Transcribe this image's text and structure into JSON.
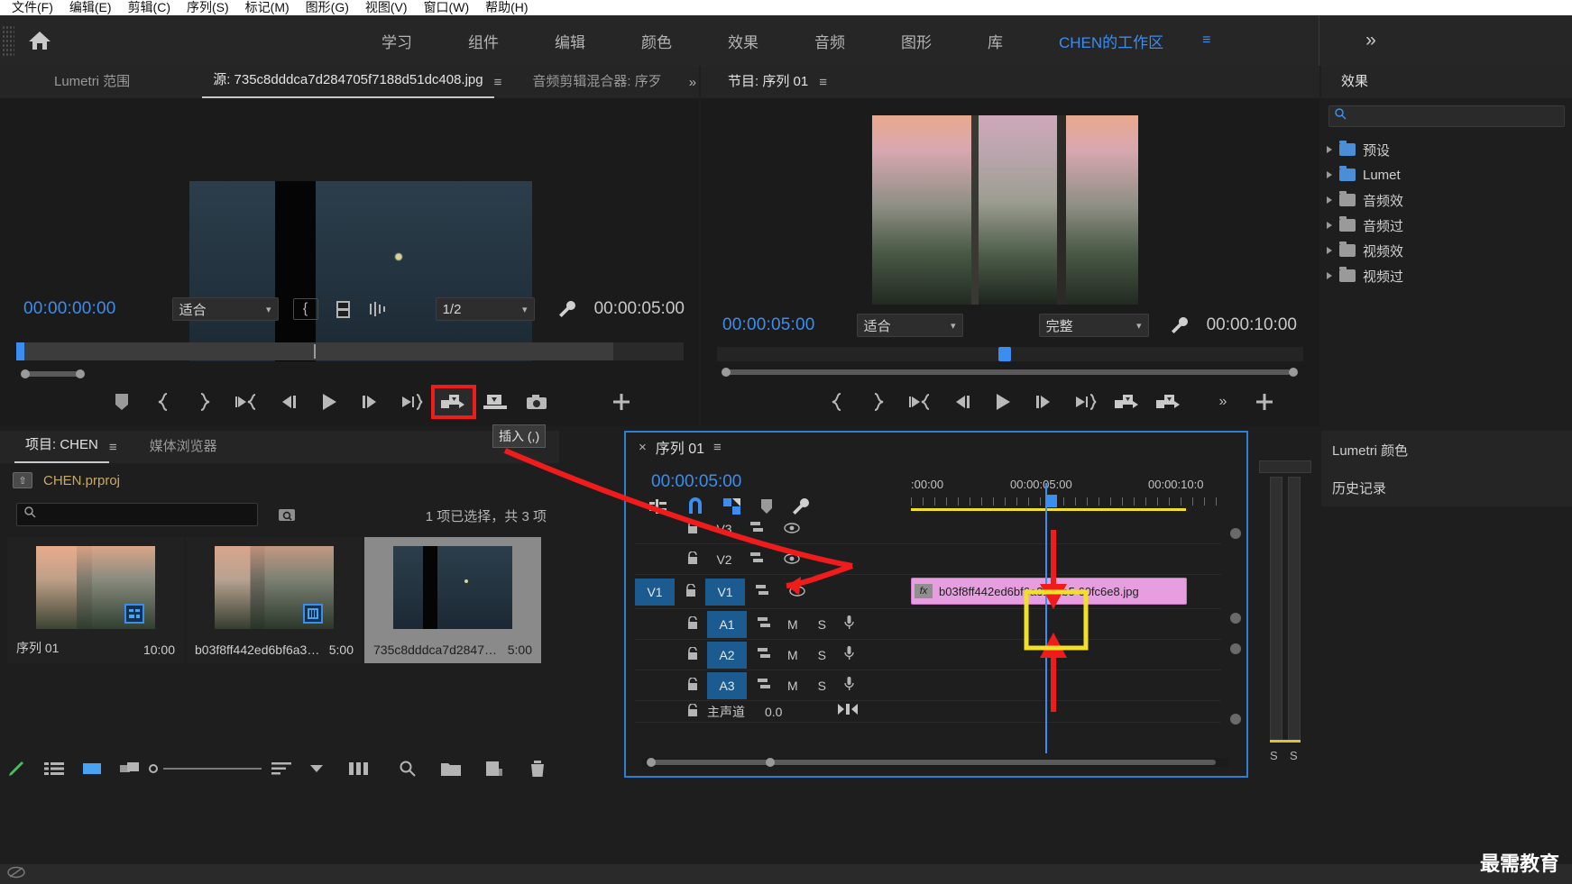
{
  "menubar": {
    "items": [
      "文件(F)",
      "编辑(E)",
      "剪辑(C)",
      "序列(S)",
      "标记(M)",
      "图形(G)",
      "视图(V)",
      "窗口(W)",
      "帮助(H)"
    ]
  },
  "workspace": {
    "home_icon": "home-icon",
    "tabs": [
      "学习",
      "组件",
      "编辑",
      "颜色",
      "效果",
      "音频",
      "图形",
      "库"
    ],
    "active_workspace": "CHEN的工作区",
    "menu_icon": "hamburger-icon",
    "more_icon": "double-chevron-right-icon",
    "accent": "#3b8ef0"
  },
  "source_panel": {
    "tabs": [
      {
        "label": "Lumetri 范围",
        "active": false
      },
      {
        "label": "源: 735c8dddca7d284705f7188d51dc408.jpg",
        "active": true
      },
      {
        "label": "音频剪辑混合器: 序歹",
        "active": false
      }
    ],
    "hamburger": "≡",
    "overflow": "»",
    "current_time": "00:00:00:00",
    "fit_value": "适合",
    "resolution_value": "1/2",
    "duration": "00:00:05:00",
    "wrench_icon": "wrench-icon",
    "marker_in_icon": "mark-in-icon",
    "export_frame_icon": "export-frame-icon",
    "settings_icon": "settings-icon"
  },
  "source_transport": {
    "buttons": [
      {
        "name": "add-marker-button",
        "glyph": "marker"
      },
      {
        "name": "mark-in-button",
        "glyph": "{"
      },
      {
        "name": "mark-out-button",
        "glyph": "}"
      },
      {
        "name": "go-to-in-button",
        "glyph": "goin"
      },
      {
        "name": "step-back-button",
        "glyph": "stepback"
      },
      {
        "name": "play-button",
        "glyph": "play"
      },
      {
        "name": "step-forward-button",
        "glyph": "stepfwd"
      },
      {
        "name": "go-to-out-button",
        "glyph": "goout"
      },
      {
        "name": "insert-button",
        "glyph": "insert",
        "highlighted": true
      },
      {
        "name": "overwrite-button",
        "glyph": "overwrite"
      },
      {
        "name": "export-frame-button",
        "glyph": "camera"
      },
      {
        "name": "button-editor-button",
        "glyph": "+"
      }
    ],
    "tooltip": "插入 (,)",
    "highlight_color": "#f01c1c"
  },
  "program_panel": {
    "title": "节目: 序列 01",
    "hamburger": "≡",
    "current_time": "00:00:05:00",
    "fit_value": "适合",
    "quality_value": "完整",
    "duration": "00:00:10:00"
  },
  "program_transport": {
    "buttons": [
      {
        "name": "mark-in-button",
        "glyph": "{"
      },
      {
        "name": "mark-out-button",
        "glyph": "}"
      },
      {
        "name": "go-to-in-button",
        "glyph": "goin"
      },
      {
        "name": "step-back-button",
        "glyph": "stepback"
      },
      {
        "name": "play-button",
        "glyph": "play"
      },
      {
        "name": "step-forward-button",
        "glyph": "stepfwd"
      },
      {
        "name": "go-to-out-button",
        "glyph": "goout"
      },
      {
        "name": "lift-button",
        "glyph": "insert"
      },
      {
        "name": "extract-button",
        "glyph": "overwrite"
      }
    ],
    "overflow": "»",
    "plus": "+"
  },
  "effects_panel": {
    "title": "效果",
    "search_icon": "search-icon",
    "search_value": "",
    "rows": [
      {
        "label": "预设",
        "icon": "star-folder-icon"
      },
      {
        "label": "Lumet",
        "icon": "star-folder-icon"
      },
      {
        "label": "音频效",
        "icon": "folder-icon"
      },
      {
        "label": "音频过",
        "icon": "folder-icon"
      },
      {
        "label": "视频效",
        "icon": "folder-icon"
      },
      {
        "label": "视频过",
        "icon": "folder-icon"
      }
    ],
    "lumetri_tab": "Lumetri 颜色",
    "history_tab": "历史记录"
  },
  "project_panel": {
    "tabs": [
      {
        "label": "项目: CHEN",
        "active": true
      },
      {
        "label": "媒体浏览器",
        "active": false
      }
    ],
    "hamburger": "≡",
    "root_name": "CHEN.prproj",
    "search_placeholder": "",
    "search_value": "",
    "find_icon": "find-icon",
    "selection_status": "1 项已选择，共 3 项",
    "items": [
      {
        "name": "序列 01",
        "duration": "10:00",
        "badge": "sequence-icon",
        "selected": false
      },
      {
        "name": "b03f8ff442ed6bf6a31d...",
        "duration": "5:00",
        "badge": "filmstrip-icon",
        "selected": false
      },
      {
        "name": "735c8dddca7d284705f...",
        "duration": "5:00",
        "badge": "",
        "selected": true
      }
    ],
    "toolbar": [
      {
        "name": "pen-icon"
      },
      {
        "name": "list-view-icon"
      },
      {
        "name": "icon-view-icon"
      },
      {
        "name": "freeform-view-icon"
      },
      {
        "name": "zoom-slider"
      },
      {
        "name": "sort-icon"
      },
      {
        "name": "chevron-down-icon"
      },
      {
        "name": "columns-icon"
      },
      {
        "name": "find-icon"
      },
      {
        "name": "new-bin-icon"
      },
      {
        "name": "new-item-icon"
      },
      {
        "name": "delete-icon"
      }
    ]
  },
  "timeline_panel": {
    "close_icon": "×",
    "title": "序列 01",
    "hamburger": "≡",
    "playhead_time": "00:00:05:00",
    "tools": [
      {
        "name": "selection-tool",
        "glyph": "arrow",
        "active": true
      },
      {
        "name": "track-select-forward-tool",
        "glyph": "trackselect"
      },
      {
        "name": "ripple-edit-tool",
        "glyph": "ripple"
      },
      {
        "name": "rolling-edit-tool",
        "glyph": "roll"
      },
      {
        "name": "rate-stretch-tool",
        "glyph": "rate"
      },
      {
        "name": "pen-tool",
        "glyph": "pen"
      },
      {
        "name": "hand-tool",
        "glyph": "hand"
      },
      {
        "name": "type-tool",
        "glyph": "T"
      }
    ],
    "toolrow": [
      {
        "name": "insert-overwrite-indicator-icon"
      },
      {
        "name": "snap-icon"
      },
      {
        "name": "linked-selection-icon"
      },
      {
        "name": "add-marker-icon"
      },
      {
        "name": "timeline-settings-icon"
      }
    ],
    "ruler_labels": [
      ":00:00",
      "00:00:05:00",
      "00:00:10:0"
    ],
    "tracks": [
      {
        "id": "V3",
        "type": "video",
        "lock": "🔓",
        "sync": true,
        "eye": true,
        "targeted": false
      },
      {
        "id": "V2",
        "type": "video",
        "lock": "🔓",
        "sync": true,
        "eye": true,
        "targeted": false
      },
      {
        "id": "V1",
        "type": "video",
        "lock": "🔓",
        "sync": true,
        "eye": true,
        "targeted": true
      },
      {
        "id": "A1",
        "type": "audio",
        "lock": "🔓",
        "sync": true,
        "mute": "M",
        "solo": "S",
        "mic": true,
        "targeted": true
      },
      {
        "id": "A2",
        "type": "audio",
        "lock": "🔓",
        "sync": true,
        "mute": "M",
        "solo": "S",
        "mic": true,
        "targeted": true
      },
      {
        "id": "A3",
        "type": "audio",
        "lock": "🔓",
        "sync": true,
        "mute": "M",
        "solo": "S",
        "mic": true,
        "targeted": true
      },
      {
        "id": "主声道",
        "type": "master",
        "lock": "🔓",
        "level": "0.0"
      }
    ],
    "clip": {
      "name": "b03f8ff442ed6bf6a31dcb5 60fc6e8.jpg",
      "fx_badge": "fx",
      "color": "#e79ee0"
    }
  },
  "annotations": {
    "arrow_color": "#f01c1c",
    "highlight_box_color": "#f2e028",
    "watermark": "最需教育"
  }
}
